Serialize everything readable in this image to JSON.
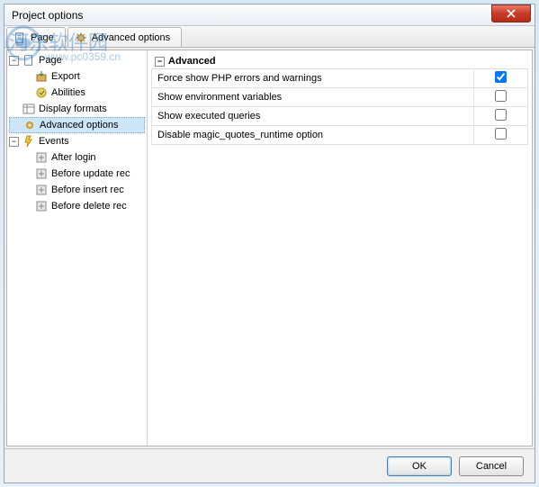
{
  "title": "Project options",
  "tabs": [
    {
      "label": "Page"
    },
    {
      "label": "Advanced options"
    }
  ],
  "tree": {
    "page": {
      "label": "Page"
    },
    "export": {
      "label": "Export"
    },
    "abilities": {
      "label": "Abilities"
    },
    "display_formats": {
      "label": "Display formats"
    },
    "advanced_options": {
      "label": "Advanced options"
    },
    "events": {
      "label": "Events"
    },
    "after_login": {
      "label": "After login"
    },
    "before_update": {
      "label": "Before update rec"
    },
    "before_insert": {
      "label": "Before insert rec"
    },
    "before_delete": {
      "label": "Before delete rec"
    }
  },
  "section": {
    "title": "Advanced"
  },
  "options": [
    {
      "label": "Force show PHP errors and warnings",
      "checked": true
    },
    {
      "label": "Show environment variables",
      "checked": false
    },
    {
      "label": "Show executed queries",
      "checked": false
    },
    {
      "label": "Disable magic_quotes_runtime option",
      "checked": false
    }
  ],
  "buttons": {
    "ok": "OK",
    "cancel": "Cancel"
  },
  "watermark": {
    "main": "河东软件园",
    "sub": "www.pc0359.cn"
  }
}
